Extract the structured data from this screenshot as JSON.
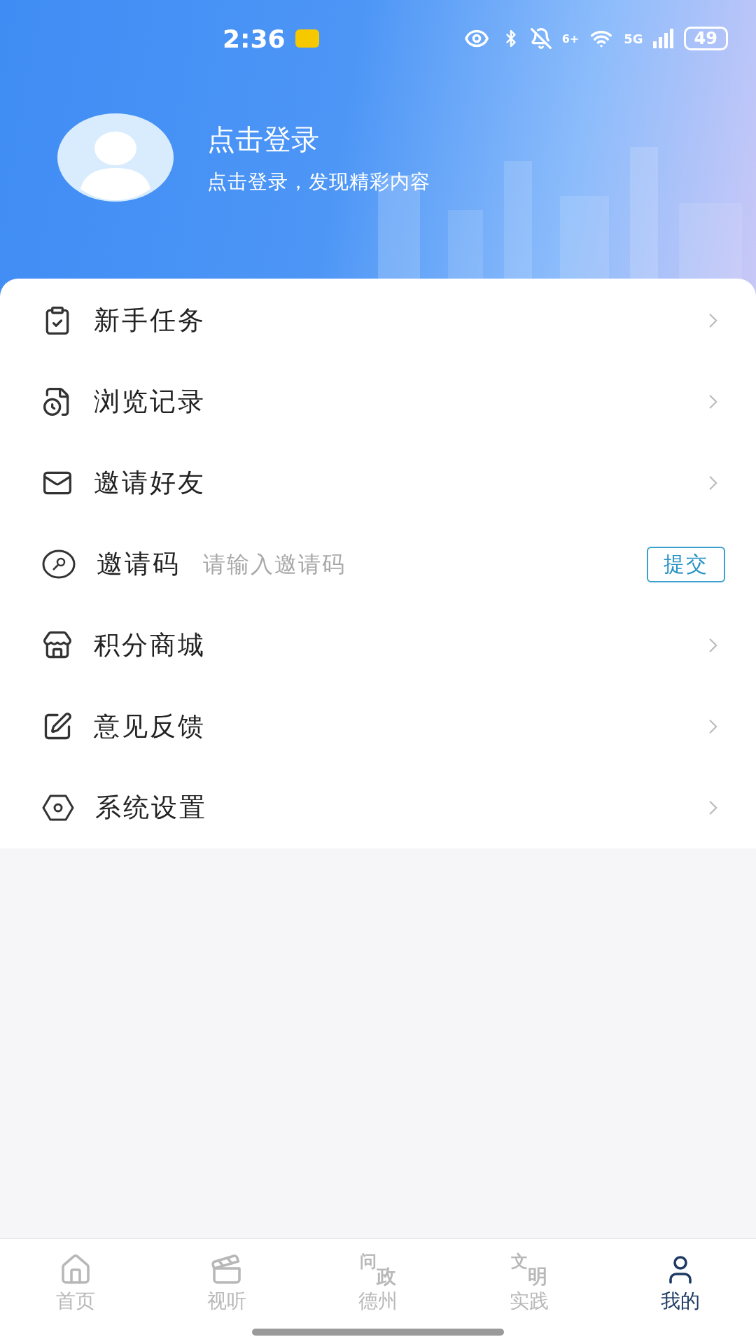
{
  "status_bar": {
    "time": "2:36",
    "network_sup": "6+",
    "network": "5G",
    "battery": "49"
  },
  "profile": {
    "title": "点击登录",
    "subtitle": "点击登录，发现精彩内容"
  },
  "menu": [
    {
      "kind": "link",
      "label": "新手任务"
    },
    {
      "kind": "link",
      "label": "浏览记录"
    },
    {
      "kind": "link",
      "label": "邀请好友"
    },
    {
      "kind": "input",
      "label": "邀请码",
      "placeholder": "请输入邀请码",
      "button": "提交"
    },
    {
      "kind": "link",
      "label": "积分商城"
    },
    {
      "kind": "link",
      "label": "意见反馈"
    },
    {
      "kind": "link",
      "label": "系统设置"
    }
  ],
  "bottom_nav": [
    {
      "label": "首页",
      "selected": false
    },
    {
      "label": "视听",
      "selected": false
    },
    {
      "icon_text": [
        "问",
        "政"
      ],
      "label": "德州",
      "selected": false
    },
    {
      "icon_text": [
        "文",
        "明"
      ],
      "label": "实践",
      "selected": false
    },
    {
      "label": "我的",
      "selected": true
    }
  ]
}
